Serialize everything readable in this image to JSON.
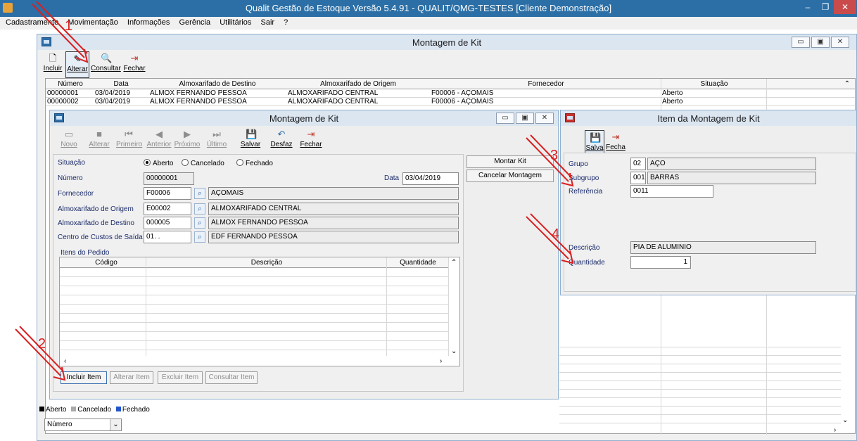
{
  "app": {
    "title": "Qualit Gestão de Estoque Versão 5.4.91 - QUALIT/QMG-TESTES [Cliente Demonstração]",
    "menu": [
      "Cadastramento",
      "Movimentação",
      "Informações",
      "Gerência",
      "Utilitários",
      "Sair",
      "?"
    ]
  },
  "main_window": {
    "title": "Montagem de Kit",
    "toolbar": [
      "Incluir",
      "Alterar",
      "Consultar",
      "Fechar"
    ],
    "columns": [
      "Número",
      "Data",
      "Almoxarifado de Destino",
      "Almoxarifado de Origem",
      "Fornecedor",
      "Situação"
    ],
    "rows": [
      {
        "numero": "00000001",
        "data": "03/04/2019",
        "destino": "ALMOX FERNANDO PESSOA",
        "origem": "ALMOXARIFADO CENTRAL",
        "fornecedor": "F00006 - AÇOMAIS",
        "situacao": "Aberto"
      },
      {
        "numero": "00000002",
        "data": "03/04/2019",
        "destino": "ALMOX FERNANDO PESSOA",
        "origem": "ALMOXARIFADO CENTRAL",
        "fornecedor": "F00006 - AÇOMAIS",
        "situacao": "Aberto"
      }
    ],
    "legend": [
      "Aberto",
      "Cancelado",
      "Fechado"
    ],
    "order_select": "Número"
  },
  "kit_window": {
    "title": "Montagem de Kit",
    "toolbar": [
      "Novo",
      "Alterar",
      "Primeiro",
      "Anterior",
      "Próximo",
      "Último",
      "Salvar",
      "Desfaz",
      "Fechar"
    ],
    "situacao_label": "Situação",
    "situacao_options": [
      "Aberto",
      "Cancelado",
      "Fechado"
    ],
    "numero_label": "Número",
    "numero": "00000001",
    "data_label": "Data",
    "data": "03/04/2019",
    "fornecedor_label": "Fornecedor",
    "fornecedor_code": "F00006",
    "fornecedor_name": "AÇOMAIS",
    "origem_label": "Almoxarifado de Origem",
    "origem_code": "E00002",
    "origem_name": "ALMOXARIFADO CENTRAL",
    "destino_label": "Almoxarifado de Destino",
    "destino_code": "000005",
    "destino_name": "ALMOX FERNANDO PESSOA",
    "centro_label": "Centro de Custos de Saída",
    "centro_code": "01.  .",
    "centro_name": "EDF FERNANDO PESSOA",
    "itens_label": "Itens do Pedido",
    "itens_columns": [
      "Código",
      "Descrição",
      "Quantidade"
    ],
    "item_buttons": [
      "Incluir Item",
      "Alterar Item",
      "Excluir Item",
      "Consultar Item"
    ],
    "side_buttons": [
      "Montar Kit",
      "Cancelar Montagem"
    ]
  },
  "item_window": {
    "title": "Item da Montagem de Kit",
    "toolbar": [
      "Salva",
      "Fecha"
    ],
    "grupo_label": "Grupo",
    "grupo_code": "02",
    "grupo_name": "AÇO",
    "subgrupo_label": "Subgrupo",
    "subgrupo_code": "001",
    "subgrupo_name": "BARRAS",
    "referencia_label": "Referência",
    "referencia": "0011",
    "descricao_label": "Descrição",
    "descricao": "PIA DE ALUMINIO",
    "quantidade_label": "Quantidade",
    "quantidade": "1"
  },
  "annotations": [
    "1",
    "2",
    "3",
    "4"
  ]
}
